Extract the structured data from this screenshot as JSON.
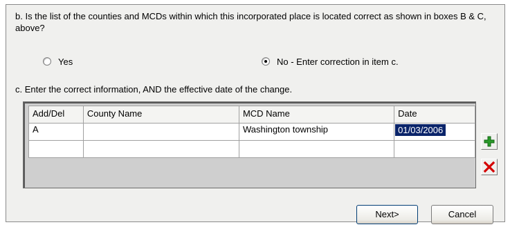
{
  "question": {
    "text": "b. Is the list of the counties and MCDs within which this incorporated place is located correct as shown in boxes B & C, above?"
  },
  "options": {
    "yes_label": "Yes",
    "no_label": "No - Enter correction in item c.",
    "selected": "no"
  },
  "instruction": "c. Enter the correct information, AND the effective date of the change.",
  "grid": {
    "columns": [
      "Add/Del",
      "County Name",
      "MCD Name",
      "Date"
    ],
    "rows": [
      {
        "add_del": "A",
        "county_name": "",
        "mcd_name": "Washington township",
        "date": "01/03/2006"
      },
      {
        "add_del": "",
        "county_name": "",
        "mcd_name": "",
        "date": ""
      }
    ]
  },
  "icons": {
    "add": "plus-icon",
    "delete": "x-icon",
    "add_color": "#2a9a2a",
    "delete_color": "#d40000"
  },
  "buttons": {
    "next_label": "Next>",
    "cancel_label": "Cancel"
  }
}
